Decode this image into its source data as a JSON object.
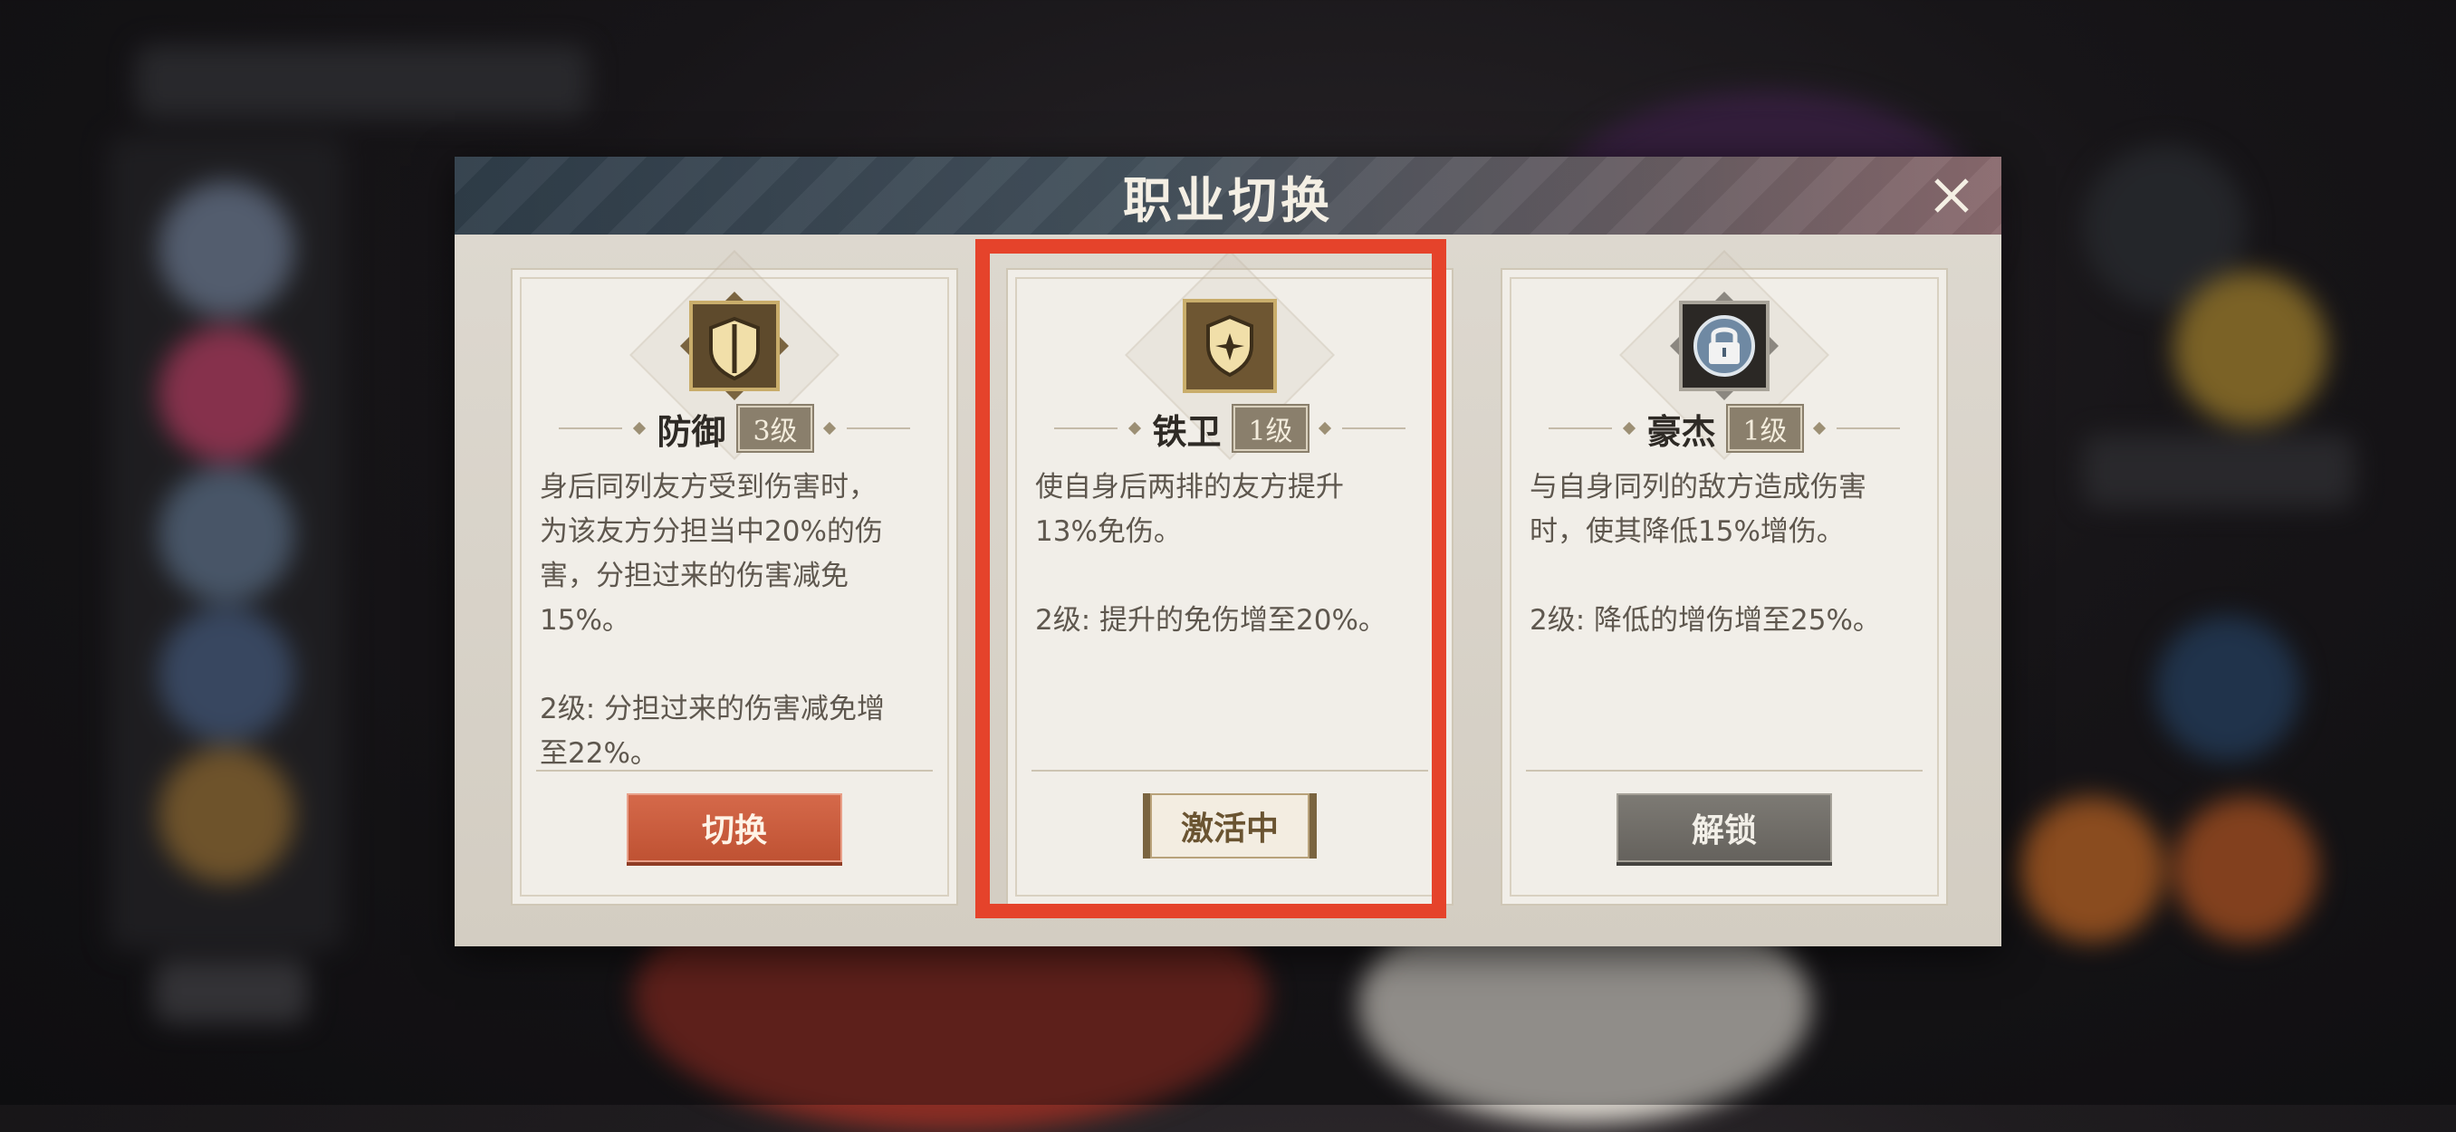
{
  "modal": {
    "title": "职业切换",
    "close_icon": "close-icon"
  },
  "cards": [
    {
      "icon": "shield-icon",
      "name": "防御",
      "level": "3级",
      "description": "身后同列友方受到伤害时，\n为该友方分担当中20%的伤\n害，分担过来的伤害减免\n15%。\n\n2级: 分担过来的伤害减免增\n至22%。",
      "action_label": "切换",
      "action_type": "switch"
    },
    {
      "icon": "guard-badge-icon",
      "name": "铁卫",
      "level": "1级",
      "description": "使自身后两排的友方提升\n13%免伤。\n\n2级: 提升的免伤增至20%。",
      "action_label": "激活中",
      "action_type": "active"
    },
    {
      "icon": "lock-icon",
      "name": "豪杰",
      "level": "1级",
      "description": "与自身同列的敌方造成伤害\n时，使其降低15%增伤。\n\n2级: 降低的增伤增至25%。",
      "action_label": "解锁",
      "action_type": "unlock"
    }
  ],
  "colors": {
    "header_start": "#2f3d49",
    "header_end": "#8a6a6e",
    "switch_button": "#c95a3b",
    "highlight": "#e5432b",
    "active_gold": "#7a6440"
  }
}
